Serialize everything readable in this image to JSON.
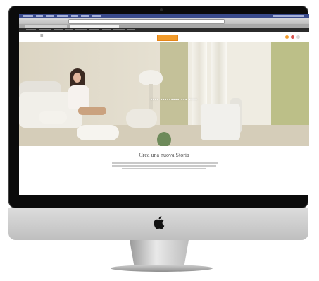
{
  "colors": {
    "bezel": "#0b0b0b",
    "aluminum": "#cfcfcf",
    "browser_menubar": "#3a4b8c",
    "site_logo": "#f29b2a",
    "hero_green": "#bcbf88"
  },
  "page": {
    "content_title": "Crea una nuova Storia"
  },
  "icons": {
    "apple_logo": "apple-logo-icon",
    "site_menu": "hamburger-menu-icon"
  }
}
